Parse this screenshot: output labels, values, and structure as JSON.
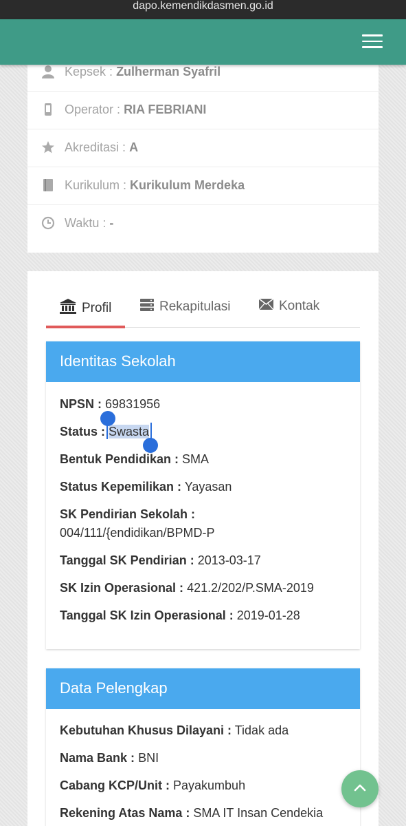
{
  "browser": {
    "url": "dapo.kemendikdasmen.go.id"
  },
  "info": [
    {
      "icon": "user-icon",
      "label": "Kepsek :",
      "value": "Zulherman Syafril"
    },
    {
      "icon": "phone-icon",
      "label": "Operator :",
      "value": "RIA FEBRIANI"
    },
    {
      "icon": "star-icon",
      "label": "Akreditasi :",
      "value": "A"
    },
    {
      "icon": "book-icon",
      "label": "Kurikulum :",
      "value": "Kurikulum Merdeka"
    },
    {
      "icon": "clock-icon",
      "label": "Waktu :",
      "value": "-"
    }
  ],
  "tabs": [
    {
      "icon": "bank-icon",
      "label": "Profil",
      "active": true
    },
    {
      "icon": "server-icon",
      "label": "Rekapitulasi",
      "active": false
    },
    {
      "icon": "envelope-icon",
      "label": "Kontak",
      "active": false
    }
  ],
  "identitas": {
    "title": "Identitas Sekolah",
    "fields": [
      {
        "label": "NPSN :",
        "value": "69831956"
      },
      {
        "label": "Status :",
        "value": "Swasta"
      },
      {
        "label": "Bentuk Pendidikan :",
        "value": "SMA"
      },
      {
        "label": "Status Kepemilikan :",
        "value": "Yayasan"
      },
      {
        "label": "SK Pendirian Sekolah :",
        "value": "004/111/{endidikan/BPMD-P"
      },
      {
        "label": "Tanggal SK Pendirian :",
        "value": "2013-03-17"
      },
      {
        "label": "SK Izin Operasional :",
        "value": "421.2/202/P.SMA-2019"
      },
      {
        "label": "Tanggal SK Izin Operasional :",
        "value": "2019-01-28"
      }
    ]
  },
  "pelengkap": {
    "title": "Data Pelengkap",
    "fields": [
      {
        "label": "Kebutuhan Khusus Dilayani :",
        "value": "Tidak ada"
      },
      {
        "label": "Nama Bank :",
        "value": "BNI"
      },
      {
        "label": "Cabang KCP/Unit :",
        "value": "Payakumbuh"
      },
      {
        "label": "Rekening Atas Nama :",
        "value": "SMA IT Insan Cendekia"
      }
    ]
  },
  "colors": {
    "navbar": "#3f9b87",
    "panel_header": "#4aa9ee",
    "tab_active_underline": "#e05a5a",
    "fab": "#72c28f"
  }
}
